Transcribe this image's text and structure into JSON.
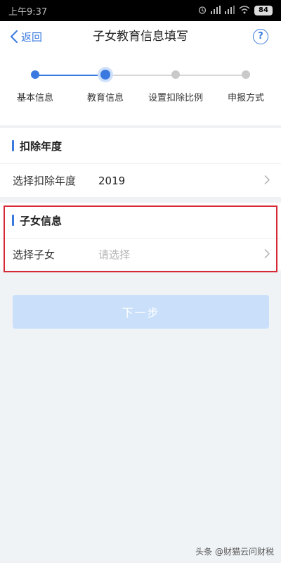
{
  "status_bar": {
    "time": "上午9:37",
    "battery": "84"
  },
  "nav": {
    "back_label": "返回",
    "title": "子女教育信息填写",
    "help_label": "?"
  },
  "stepper": {
    "steps": [
      {
        "label": "基本信息",
        "state": "done"
      },
      {
        "label": "教育信息",
        "state": "current"
      },
      {
        "label": "设置扣除比例",
        "state": "pending"
      },
      {
        "label": "申报方式",
        "state": "pending"
      }
    ]
  },
  "deduction_year": {
    "header": "扣除年度",
    "row_label": "选择扣除年度",
    "row_value": "2019"
  },
  "child_info": {
    "header": "子女信息",
    "row_label": "选择子女",
    "row_placeholder": "请选择"
  },
  "next_button": "下一步",
  "watermark": "头条 @财猫云问财税",
  "colors": {
    "accent": "#3a7ae0",
    "highlight_border": "#d62a37",
    "button_disabled": "#c9dffa"
  }
}
